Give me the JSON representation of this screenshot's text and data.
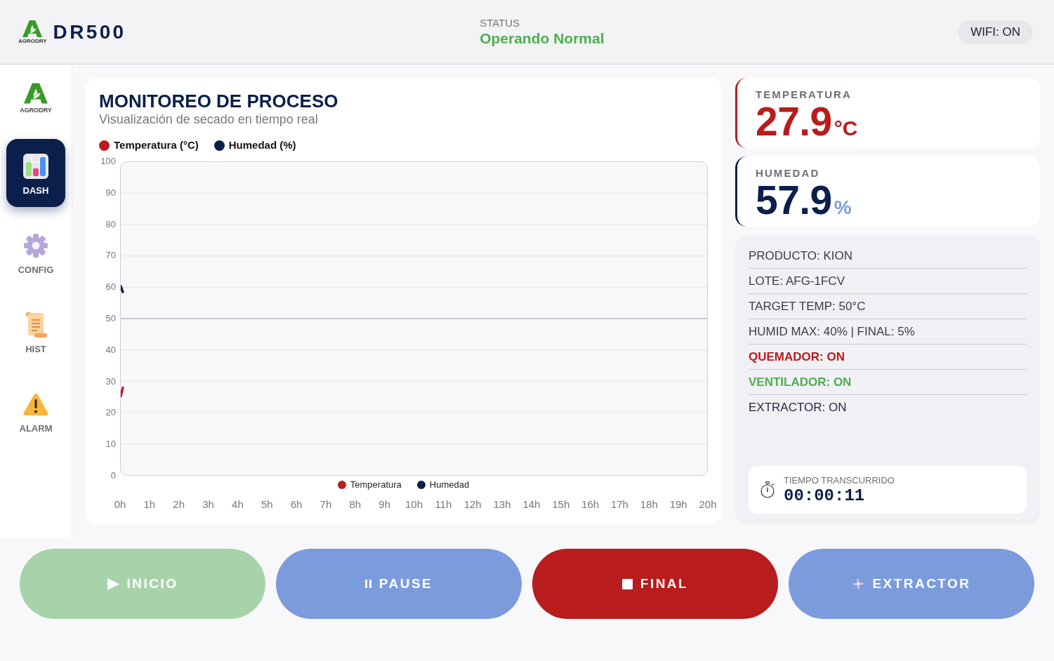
{
  "header": {
    "brand": {
      "logo_text": "AGRODRY",
      "name": "DR500"
    },
    "status": {
      "label": "STATUS",
      "value": "Operando Normal"
    },
    "wifi": "WIFI: ON"
  },
  "sidebar": {
    "logo_text": "AGRODRY",
    "items": [
      {
        "label": "DASH",
        "kind": "dashboard",
        "selected": true
      },
      {
        "label": "CONFIG",
        "kind": "settings",
        "selected": false
      },
      {
        "label": "HIST",
        "kind": "history",
        "selected": false
      },
      {
        "label": "ALARM",
        "kind": "alarm",
        "selected": false
      }
    ]
  },
  "monitor": {
    "title": "MONITOREO DE PROCESO",
    "subtitle": "Visualización de secado en tiempo real",
    "legend": [
      {
        "label": "Temperatura (°C)",
        "color": "#b91c1c"
      },
      {
        "label": "Humedad (%)",
        "color": "#0b1f4b"
      }
    ],
    "chart_data": {
      "type": "line",
      "x": [
        0,
        0.07
      ],
      "series": [
        {
          "name": "Temperatura",
          "color": "#b91c1c",
          "values": [
            25.2,
            27.9
          ]
        },
        {
          "name": "Humedad",
          "color": "#0b1f4b",
          "values": [
            60.3,
            58.5
          ]
        }
      ],
      "xlim": [
        0,
        20
      ],
      "ylim": [
        0,
        100
      ],
      "xticks": [
        {
          "value": 0,
          "label": "0h"
        },
        {
          "value": 1,
          "label": "1h"
        },
        {
          "value": 2,
          "label": "2h"
        },
        {
          "value": 3,
          "label": "3h"
        },
        {
          "value": 4,
          "label": "4h"
        },
        {
          "value": 5,
          "label": "5h"
        },
        {
          "value": 6,
          "label": "6h"
        },
        {
          "value": 7,
          "label": "7h"
        },
        {
          "value": 8,
          "label": "8h"
        },
        {
          "value": 9,
          "label": "9h"
        },
        {
          "value": 10,
          "label": "10h"
        },
        {
          "value": 11,
          "label": "11h"
        },
        {
          "value": 12,
          "label": "12h"
        },
        {
          "value": 13,
          "label": "13h"
        },
        {
          "value": 14,
          "label": "14h"
        },
        {
          "value": 15,
          "label": "15h"
        },
        {
          "value": 16,
          "label": "16h"
        },
        {
          "value": 17,
          "label": "17h"
        },
        {
          "value": 18,
          "label": "18h"
        },
        {
          "value": 19,
          "label": "19h"
        },
        {
          "value": 20,
          "label": "20h"
        }
      ],
      "yticks": [
        0,
        10,
        20,
        30,
        40,
        50,
        60,
        70,
        80,
        90,
        100
      ],
      "grid": true,
      "ref_lines": [
        {
          "axis": "y",
          "value": 50
        }
      ],
      "legend": "bottom"
    }
  },
  "readings": [
    {
      "label": "TEMPERATURA",
      "value": "27.9",
      "unit": "°C",
      "kind": "temperature"
    },
    {
      "label": "HUMEDAD",
      "value": "57.9",
      "unit": "%",
      "kind": "humidity"
    }
  ],
  "details": {
    "rows": [
      {
        "text": "PRODUCTO: KION",
        "kind": "info"
      },
      {
        "text": "LOTE: AFG-1FCV",
        "kind": "info"
      },
      {
        "text": "TARGET TEMP: 50°C",
        "kind": "info"
      },
      {
        "text": "HUMID MAX: 40% | FINAL: 5%",
        "kind": "info"
      },
      {
        "text": "QUEMADOR: ON",
        "kind": "hot"
      },
      {
        "text": "VENTILADOR: ON",
        "kind": "ok"
      },
      {
        "text": "EXTRACTOR: ON",
        "kind": "device"
      }
    ],
    "timer": {
      "label": "TIEMPO TRANSCURRIDO",
      "value": "00:00:11"
    }
  },
  "actions": [
    {
      "label": "INICIO",
      "kind": "start",
      "disabled": true
    },
    {
      "label": "PAUSE",
      "kind": "pause",
      "disabled": false
    },
    {
      "label": "FINAL",
      "kind": "stop",
      "disabled": false
    },
    {
      "label": "EXTRACTOR",
      "kind": "extractor",
      "disabled": false
    }
  ]
}
